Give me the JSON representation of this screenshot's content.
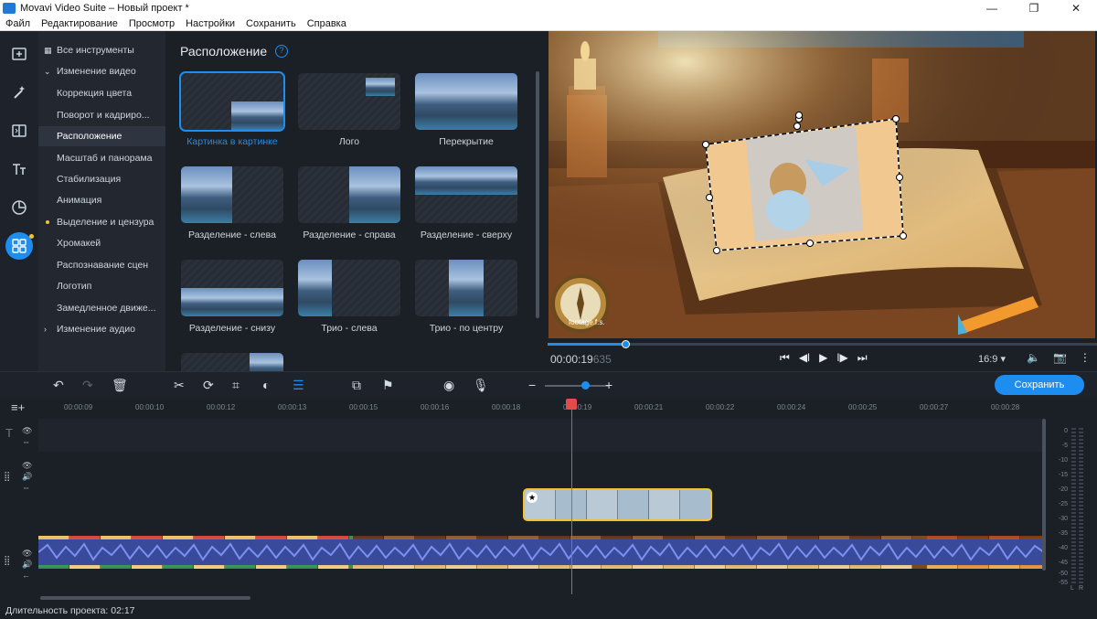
{
  "window": {
    "title": "Movavi Video Suite – Новый проект *",
    "controls": [
      "—",
      "❐",
      "✕"
    ]
  },
  "menu": [
    "Файл",
    "Редактирование",
    "Просмотр",
    "Настройки",
    "Сохранить",
    "Справка"
  ],
  "left_toolbar": [
    "import-icon",
    "magic-wand-icon",
    "transitions-icon",
    "titles-icon",
    "stickers-icon",
    "more-tools-icon"
  ],
  "categories": {
    "all_tools": "Все инструменты",
    "video_group": "Изменение видео",
    "items": [
      "Коррекция цвета",
      "Поворот и кадриро...",
      "Расположение",
      "Масштаб и панорама",
      "Стабилизация",
      "Анимация",
      "Выделение и цензура",
      "Хромакей",
      "Распознавание сцен",
      "Логотип",
      "Замедленное движе..."
    ],
    "audio_group": "Изменение аудио",
    "selected": "Расположение"
  },
  "layout_panel": {
    "title": "Расположение",
    "help": "?",
    "tiles": [
      "Картинка в картинке",
      "Лого",
      "Перекрытие",
      "Разделение - слева",
      "Разделение - справа",
      "Разделение - сверху",
      "Разделение - снизу",
      "Трио - слева",
      "Трио - по центру"
    ],
    "selected_tile": "Картинка в картинке"
  },
  "preview": {
    "timecode": "00:00:19",
    "timecode_ms": "635",
    "watermark": "footage.f.s.",
    "aspect_ratio": "16:9",
    "progress_fraction": 0.14
  },
  "timeline_toolbar": {
    "save_label": "Сохранить"
  },
  "ruler": [
    "00:00:09",
    "00:00:10",
    "00:00:12",
    "00:00:13",
    "00:00:15",
    "00:00:16",
    "00:00:18",
    "00:00:19",
    "00:00:21",
    "00:00:22",
    "00:00:24",
    "00:00:25",
    "00:00:27",
    "00:00:28"
  ],
  "vu_labels": [
    "0",
    "-5",
    "-10",
    "-15",
    "-20",
    "-25",
    "-30",
    "-35",
    "-40",
    "-45",
    "-50",
    "-55"
  ],
  "vu_lr": [
    "L",
    "R"
  ],
  "status": {
    "duration": "Длительность проекта: 02:17"
  },
  "colors": {
    "accent": "#1d8df0",
    "playhead": "#e24b4b",
    "overlay_clip_border": "#f2c230",
    "audio_wave": "#5b6ed1"
  }
}
